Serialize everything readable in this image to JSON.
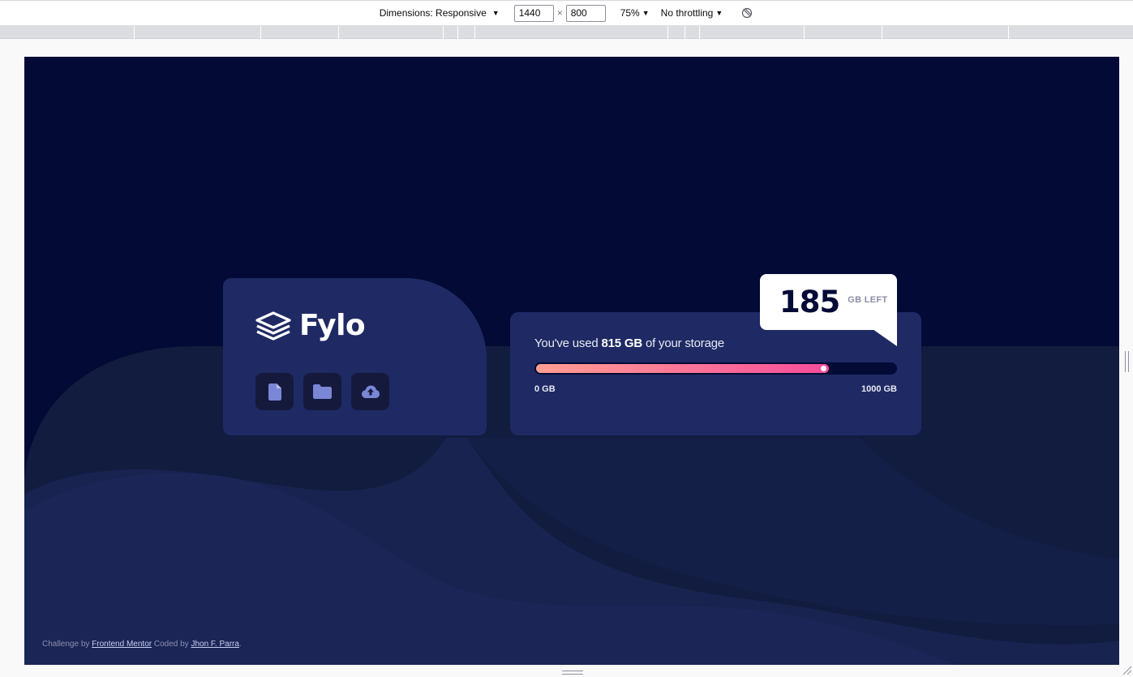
{
  "devtools": {
    "dimensions_label": "Dimensions: Responsive",
    "width_value": "1440",
    "height_value": "800",
    "times": "×",
    "zoom_label": "75%",
    "throttle_label": "No throttling"
  },
  "brand": {
    "name": "Fylo"
  },
  "icons": [
    "document-icon",
    "folder-icon",
    "upload-icon"
  ],
  "storage": {
    "text_before": "You've used ",
    "used": "815 GB",
    "text_after": " of your storage",
    "fraction_used": 0.815,
    "min_label": "0 GB",
    "max_label": "1000 GB",
    "left_value": "185",
    "left_unit": "GB LEFT"
  },
  "colors": {
    "bg_dark": "#020a35",
    "card": "#1f2a64",
    "gradient_start": "#fd9f93",
    "gradient_end": "#f64d9a",
    "icon_accent": "#7a86d6"
  },
  "footer": {
    "challenge_prefix": "Challenge by ",
    "challenge_link": "Frontend Mentor",
    "coded_prefix": " Coded by ",
    "author_link": "Jhon F. Parra",
    "suffix": "."
  }
}
